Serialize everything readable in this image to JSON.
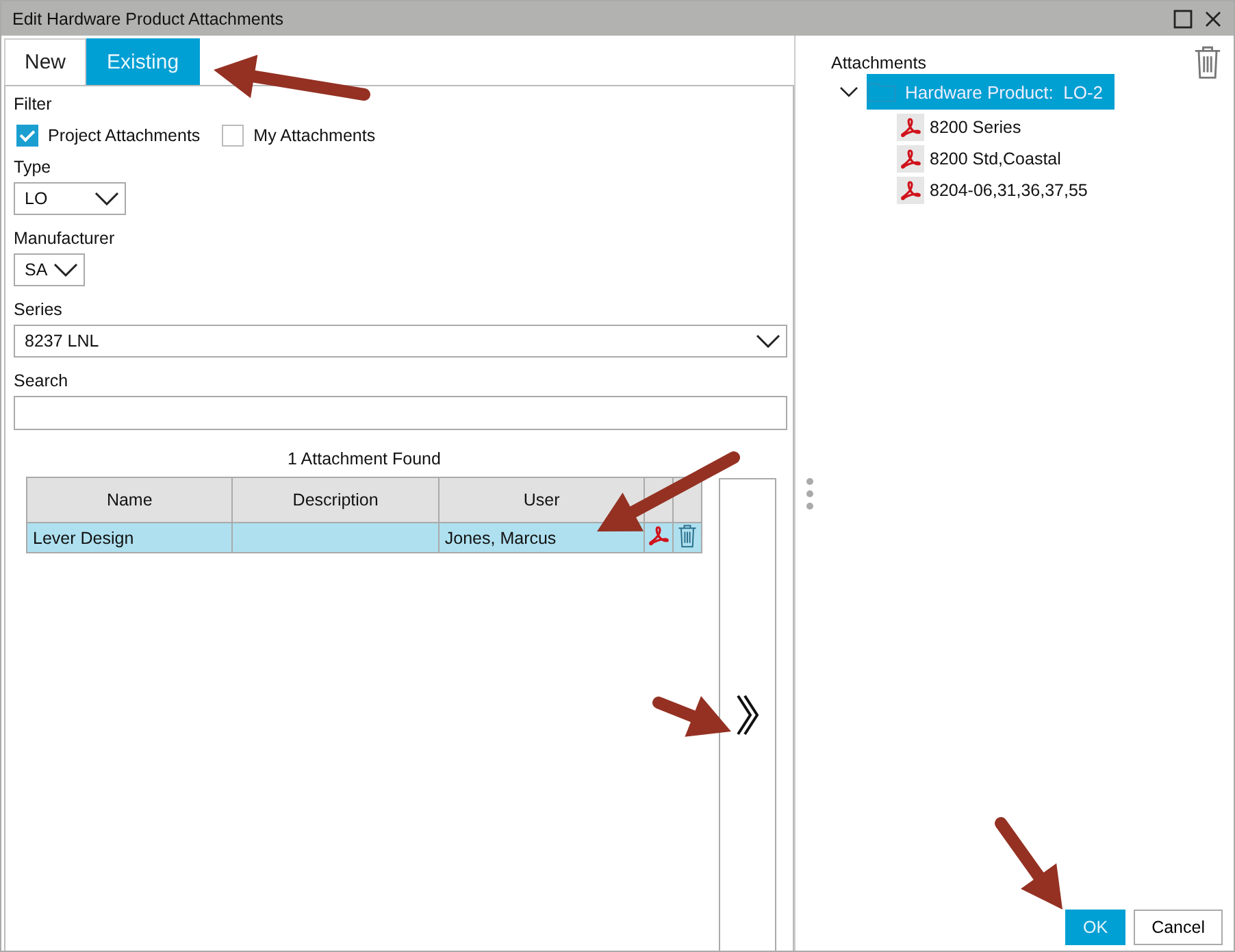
{
  "window": {
    "title": "Edit Hardware Product Attachments"
  },
  "tabs": [
    {
      "label": "New",
      "selected": false
    },
    {
      "label": "Existing",
      "selected": true
    }
  ],
  "filter": {
    "label": "Filter",
    "options": [
      {
        "label": "Project Attachments",
        "checked": true
      },
      {
        "label": "My Attachments",
        "checked": false
      }
    ]
  },
  "type": {
    "label": "Type",
    "value": "LO"
  },
  "manufacturer": {
    "label": "Manufacturer",
    "value": "SA"
  },
  "series": {
    "label": "Series",
    "value": "8237 LNL"
  },
  "search": {
    "label": "Search"
  },
  "results": {
    "count": "1 Attachment Found",
    "columns": [
      "Name",
      "Description",
      "User"
    ],
    "rows": [
      {
        "name": "Lever Design",
        "user": "Jones, Marcus",
        "selected": true
      }
    ]
  },
  "attachments": {
    "label": "Attachments",
    "tree": [
      {
        "label": "Hardware Product:  LO-2",
        "expanded": true,
        "selected": true,
        "children": [
          {
            "label": "8200 Series"
          },
          {
            "label": "8200 Std,Coastal"
          },
          {
            "label": "8204-06,31,36,37,55"
          }
        ]
      }
    ]
  },
  "buttons": [
    {
      "label": "OK",
      "kind": "primary"
    },
    {
      "label": "Cancel",
      "kind": "secondary"
    }
  ]
}
